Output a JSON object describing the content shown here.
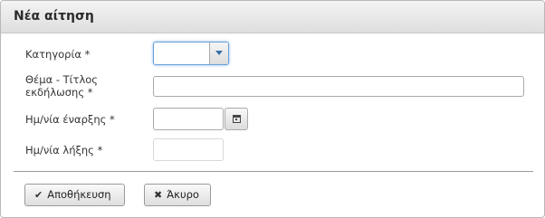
{
  "dialog": {
    "title": "Νέα αίτηση"
  },
  "form": {
    "category": {
      "label": "Κατηγορία",
      "required_mark": "*",
      "value": ""
    },
    "subject": {
      "label_line1": "Θέμα - Τίτλος",
      "label_line2": "εκδήλωσης",
      "required_mark": "*",
      "value": ""
    },
    "start_date": {
      "label": "Ημ/νία έναρξης",
      "required_mark": "*",
      "value": ""
    },
    "end_date": {
      "label": "Ημ/νία λήξης",
      "required_mark": "*",
      "value": ""
    }
  },
  "buttons": {
    "save": {
      "label": "Αποθήκευση",
      "icon": "✔"
    },
    "cancel": {
      "label": "Άκυρο",
      "icon": "✖"
    }
  }
}
